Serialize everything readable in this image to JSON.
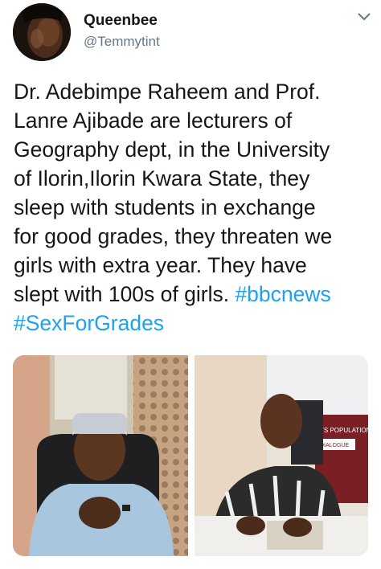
{
  "user": {
    "display_name": "Queenbee",
    "handle": "@Temmytint"
  },
  "icons": {
    "menu": "chevron-down-icon",
    "avatar": "avatar-photo"
  },
  "tweet": {
    "lines": [
      "Dr. Adebimpe Raheem and Prof.",
      "Lanre Ajibade are lecturers of",
      "Geography dept, in the University",
      "of Ilorin,Ilorin Kwara State, they",
      "sleep with students in exchange",
      "for good grades, they threaten we",
      "girls with extra year. They have",
      "slept with 100s of girls. "
    ],
    "hashtags": [
      "#bbcnews",
      "#SexForGrades"
    ]
  },
  "media": {
    "photo_left": "photo",
    "photo_right_poster": [
      "TS POPULATION",
      "DIALOGUE"
    ]
  },
  "colors": {
    "link": "#1da1f2",
    "text": "#14171a",
    "secondary": "#657786"
  }
}
